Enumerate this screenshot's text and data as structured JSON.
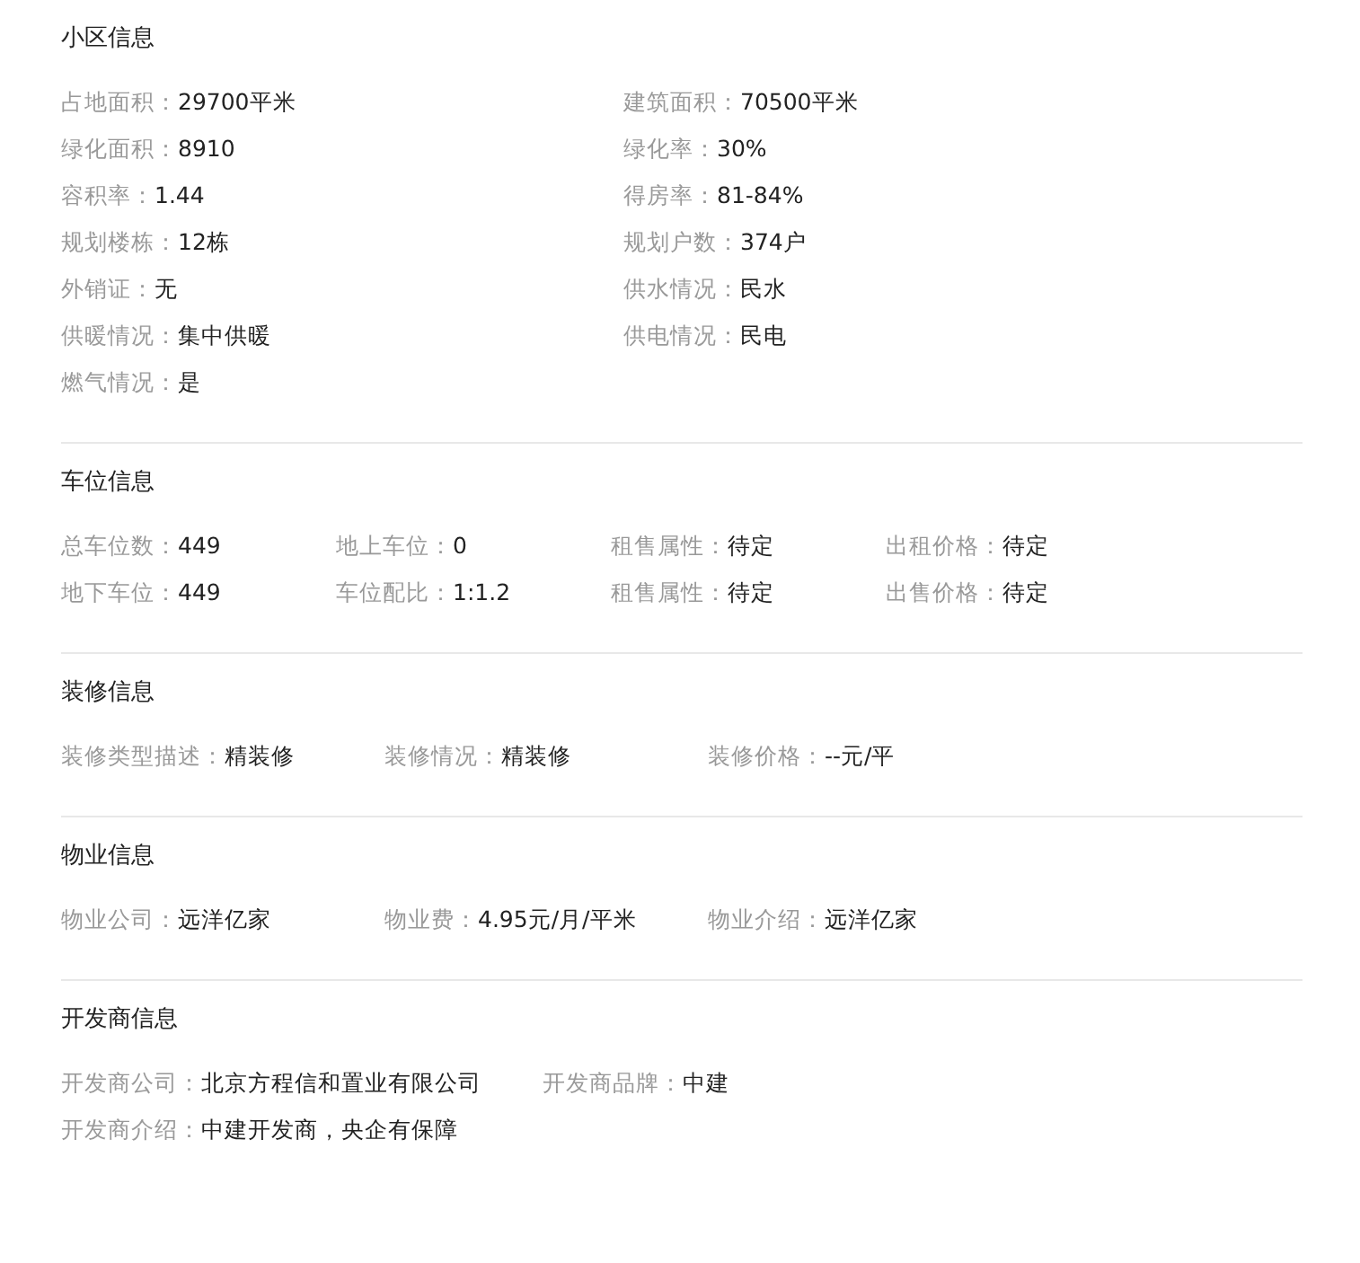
{
  "sections": [
    {
      "title": "小区信息",
      "kind": "grid2",
      "rows": [
        [
          {
            "label": "占地面积：",
            "value": "29700平米"
          },
          {
            "label": "建筑面积：",
            "value": "70500平米"
          }
        ],
        [
          {
            "label": "绿化面积：",
            "value": "8910"
          },
          {
            "label": "绿化率：",
            "value": "30%"
          }
        ],
        [
          {
            "label": "容积率：",
            "value": "1.44"
          },
          {
            "label": "得房率：",
            "value": "81-84%"
          }
        ],
        [
          {
            "label": "规划楼栋：",
            "value": "12栋"
          },
          {
            "label": "规划户数：",
            "value": "374户"
          }
        ],
        [
          {
            "label": "外销证：",
            "value": "无"
          },
          {
            "label": "供水情况：",
            "value": "民水"
          }
        ],
        [
          {
            "label": "供暖情况：",
            "value": "集中供暖"
          },
          {
            "label": "供电情况：",
            "value": "民电"
          }
        ],
        [
          {
            "label": "燃气情况：",
            "value": "是"
          }
        ]
      ]
    },
    {
      "title": "车位信息",
      "kind": "grid4",
      "rows": [
        [
          {
            "label": "总车位数：",
            "value": "449"
          },
          {
            "label": "地上车位：",
            "value": "0"
          },
          {
            "label": "租售属性：",
            "value": "待定"
          },
          {
            "label": "出租价格：",
            "value": "待定"
          }
        ],
        [
          {
            "label": "地下车位：",
            "value": "449"
          },
          {
            "label": "车位配比：",
            "value": "1:1.2"
          },
          {
            "label": "租售属性：",
            "value": "待定"
          },
          {
            "label": "出售价格：",
            "value": "待定"
          }
        ]
      ]
    },
    {
      "title": "装修信息",
      "kind": "flow",
      "rows": [
        [
          {
            "label": "装修类型描述：",
            "value": "精装修"
          },
          {
            "label": "装修情况：",
            "value": "精装修"
          },
          {
            "label": "装修价格：",
            "value": "--元/平"
          }
        ]
      ]
    },
    {
      "title": "物业信息",
      "kind": "flow",
      "rows": [
        [
          {
            "label": "物业公司：",
            "value": "远洋亿家"
          },
          {
            "label": "物业费：",
            "value": "4.95元/月/平米"
          },
          {
            "label": "物业介绍：",
            "value": "远洋亿家"
          }
        ]
      ]
    },
    {
      "title": "开发商信息",
      "kind": "flow",
      "rows": [
        [
          {
            "label": "开发商公司：",
            "value": "北京方程信和置业有限公司"
          },
          {
            "label": "开发商品牌：",
            "value": "中建"
          }
        ],
        [
          {
            "label": "开发商介绍：",
            "value": "中建开发商，央企有保障"
          }
        ]
      ]
    }
  ]
}
